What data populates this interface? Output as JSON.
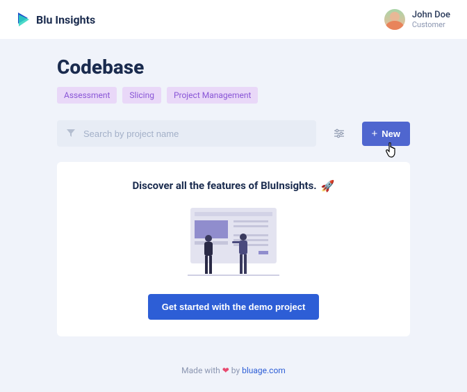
{
  "brand": {
    "name": "Blu Insights"
  },
  "user": {
    "name": "John Doe",
    "role": "Customer"
  },
  "page": {
    "title": "Codebase"
  },
  "tags": [
    "Assessment",
    "Slicing",
    "Project Management"
  ],
  "search": {
    "placeholder": "Search by project name"
  },
  "new_button": {
    "label": "New"
  },
  "discover": {
    "title": "Discover all the features of BluInsights.",
    "cta": "Get started with the demo project"
  },
  "footer": {
    "prefix": "Made with ",
    "mid": " by ",
    "link": "bluage.com"
  }
}
